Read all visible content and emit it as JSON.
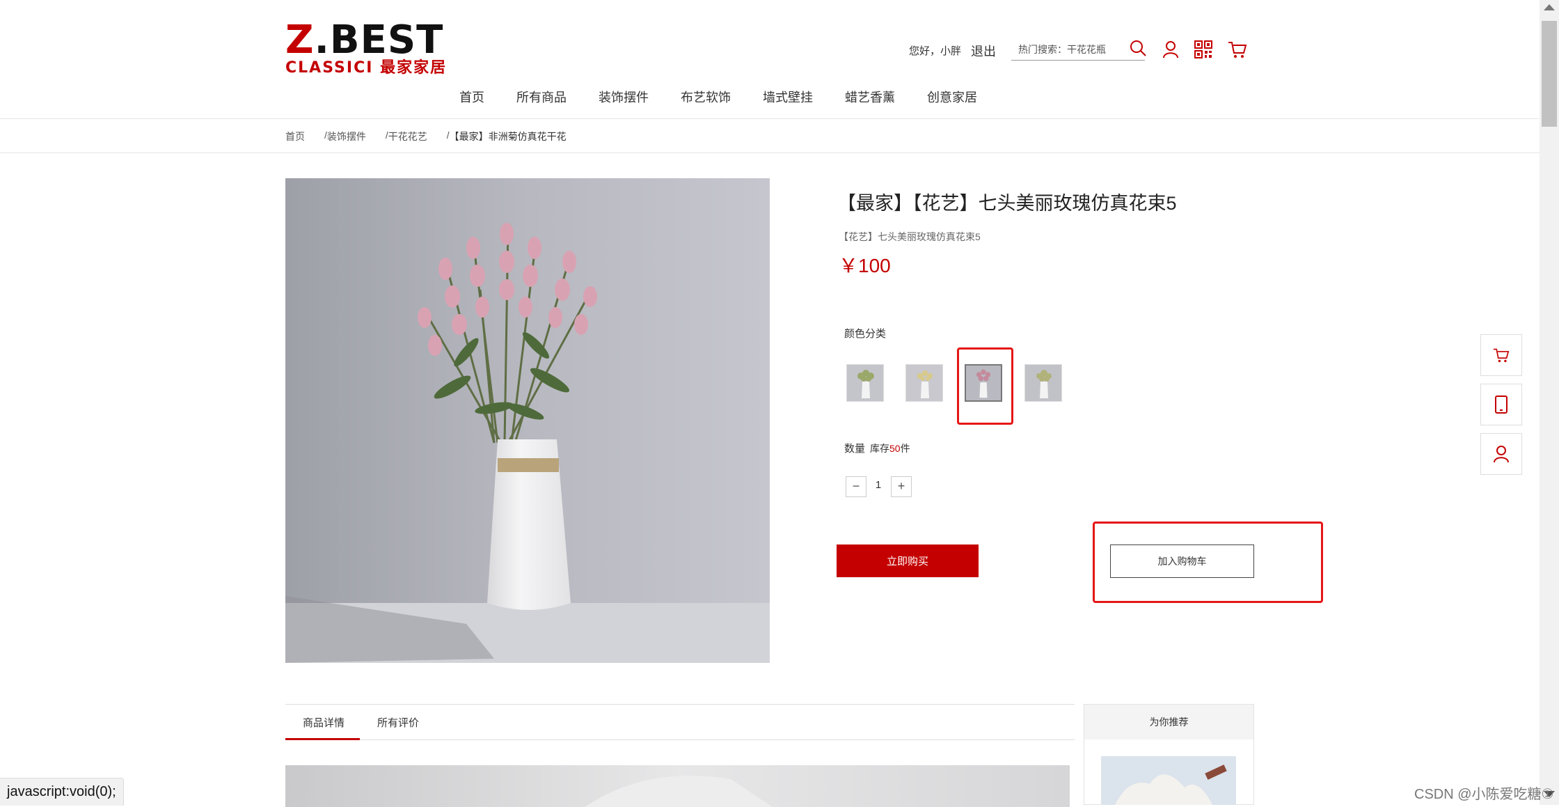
{
  "brand": {
    "logo_main_prefix": "Z",
    "logo_main_rest": ".BEST",
    "logo_sub": "CLASSICI 最家家居"
  },
  "header": {
    "greeting": "您好，小胖",
    "logout": "退出",
    "search_placeholder": "热门搜索：干花花瓶",
    "icons": [
      "search-icon",
      "user-icon",
      "qrcode-icon",
      "cart-icon"
    ]
  },
  "nav": {
    "items": [
      "首页",
      "所有商品",
      "装饰摆件",
      "布艺软饰",
      "墙式壁挂",
      "蜡艺香薰",
      "创意家居"
    ]
  },
  "breadcrumb": {
    "items": [
      "首页",
      "装饰摆件",
      "干花花艺",
      "【最家】非洲菊仿真花干花"
    ],
    "separator": "/"
  },
  "product": {
    "title": "【最家】【花艺】七头美丽玫瑰仿真花束5",
    "subtitle": "【花艺】七头美丽玫瑰仿真花束5",
    "price": "￥100",
    "color_label": "颜色分类",
    "swatches": [
      {
        "name": "green-white",
        "flower": "#9aa86a"
      },
      {
        "name": "yellow",
        "flower": "#d9c98a"
      },
      {
        "name": "pink",
        "flower": "#c48a9c",
        "selected": true
      },
      {
        "name": "mixed",
        "flower": "#b0b27a"
      }
    ],
    "qty_label": "数量",
    "stock_prefix": "库存",
    "stock_num": "50",
    "stock_suffix": "件",
    "qty_minus": "−",
    "qty_value": "1",
    "qty_plus": "+",
    "buy_now": "立即购买",
    "add_to_cart": "加入购物车"
  },
  "side_float": [
    "cart-icon",
    "phone-icon",
    "user-icon"
  ],
  "tabs": {
    "items": [
      "商品详情",
      "所有评价"
    ],
    "active": 0
  },
  "recommend": {
    "title": "为你推荐"
  },
  "status_bar": "javascript:void(0);",
  "watermark": "CSDN @小陈爱吃糖①",
  "colors": {
    "accent": "#c40000",
    "highlight_box": "#e51616"
  }
}
